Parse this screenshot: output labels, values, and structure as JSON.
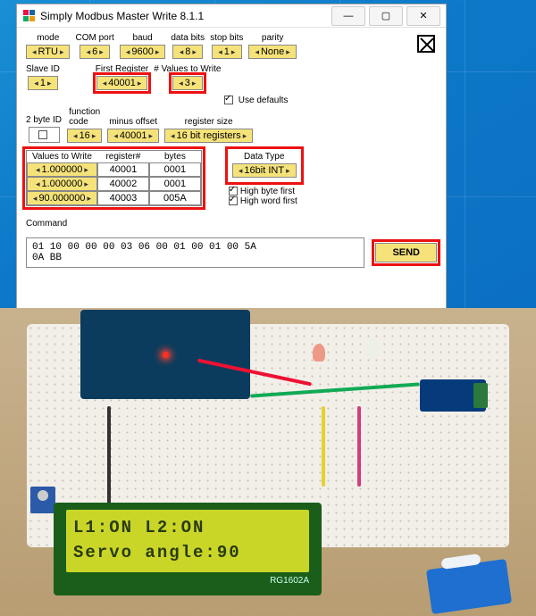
{
  "window": {
    "title": "Simply Modbus Master Write 8.1.1",
    "icon_colors": [
      "#e14",
      "#16a",
      "#1a6",
      "#e91"
    ]
  },
  "config": {
    "mode": {
      "label": "mode",
      "value": "RTU"
    },
    "com": {
      "label": "COM port",
      "value": "6"
    },
    "baud": {
      "label": "baud",
      "value": "9600"
    },
    "databits": {
      "label": "data bits",
      "value": "8"
    },
    "stopbits": {
      "label": "stop bits",
      "value": "1"
    },
    "parity": {
      "label": "parity",
      "value": "None"
    },
    "slave": {
      "label": "Slave ID",
      "value": "1"
    },
    "first_reg": {
      "label": "First Register",
      "value": "40001"
    },
    "nvals": {
      "label": "# Values to Write",
      "value": "3"
    },
    "use_defaults": {
      "label": "Use defaults",
      "checked": true
    },
    "byte_id": {
      "label": "2 byte ID",
      "checked": false
    },
    "func": {
      "label": "function\ncode",
      "value": "16"
    },
    "minus": {
      "label": "minus offset",
      "value": "40001"
    },
    "regsize": {
      "label": "register size",
      "value": "16 bit registers"
    }
  },
  "values_table": {
    "headers": [
      "Values to Write",
      "register#",
      "bytes"
    ],
    "rows": [
      {
        "value": "1.000000",
        "reg": "40001",
        "bytes": "0001"
      },
      {
        "value": "1.000000",
        "reg": "40002",
        "bytes": "0001"
      },
      {
        "value": "90.000000",
        "reg": "40003",
        "bytes": "005A"
      }
    ]
  },
  "datatype": {
    "label": "Data Type",
    "value": "16bit INT",
    "high_byte": {
      "label": "High byte first",
      "checked": true
    },
    "high_word": {
      "label": "High word first",
      "checked": true
    }
  },
  "command": {
    "label": "Command",
    "text": "01 10 00 00 00 03 06 00 01 00 01 00 5A\n0A BB",
    "send": "SEND"
  },
  "lcd": {
    "line1": "L1:ON   L2:ON",
    "line2": "Servo angle:90",
    "model": "RG1602A"
  }
}
